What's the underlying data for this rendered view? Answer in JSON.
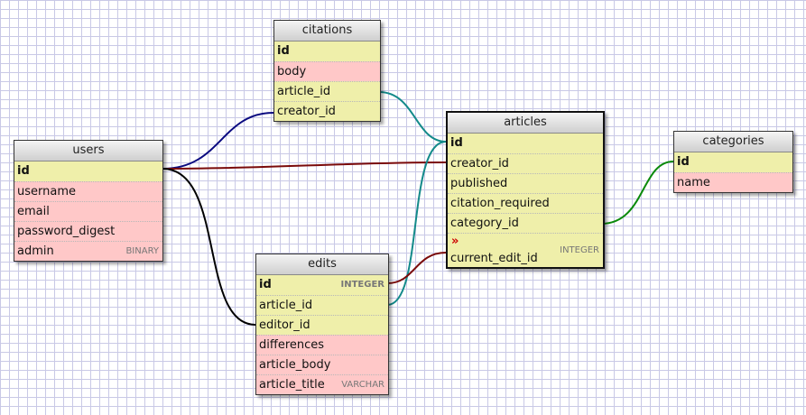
{
  "tables": {
    "citations": {
      "title": "citations",
      "fields": [
        {
          "name": "id",
          "type": ""
        },
        {
          "name": "body",
          "type": ""
        },
        {
          "name": "article_id",
          "type": ""
        },
        {
          "name": "creator_id",
          "type": ""
        }
      ]
    },
    "users": {
      "title": "users",
      "fields": [
        {
          "name": "id",
          "type": ""
        },
        {
          "name": "username",
          "type": ""
        },
        {
          "name": "email",
          "type": ""
        },
        {
          "name": "password_digest",
          "type": ""
        },
        {
          "name": "admin",
          "type": "BINARY"
        }
      ]
    },
    "articles": {
      "title": "articles",
      "fields": [
        {
          "name": "id",
          "type": ""
        },
        {
          "name": "creator_id",
          "type": ""
        },
        {
          "name": "published",
          "type": ""
        },
        {
          "name": "citation_required",
          "type": ""
        },
        {
          "name": "category_id",
          "type": ""
        },
        {
          "name": "current_edit_id",
          "type": "INTEGER",
          "marker": "»"
        }
      ]
    },
    "categories": {
      "title": "categories",
      "fields": [
        {
          "name": "id",
          "type": ""
        },
        {
          "name": "name",
          "type": ""
        }
      ]
    },
    "edits": {
      "title": "edits",
      "fields": [
        {
          "name": "id",
          "type": "INTEGER"
        },
        {
          "name": "article_id",
          "type": ""
        },
        {
          "name": "editor_id",
          "type": ""
        },
        {
          "name": "differences",
          "type": ""
        },
        {
          "name": "article_body",
          "type": ""
        },
        {
          "name": "article_title",
          "type": "VARCHAR"
        }
      ]
    }
  },
  "relations": [
    {
      "from": "citations.creator_id",
      "to": "users.id",
      "color": "#0a0a80"
    },
    {
      "from": "citations.article_id",
      "to": "articles.id",
      "color": "#138a8a"
    },
    {
      "from": "articles.creator_id",
      "to": "users.id",
      "color": "#7a0a0a"
    },
    {
      "from": "edits.editor_id",
      "to": "users.id",
      "color": "#000000"
    },
    {
      "from": "edits.article_id",
      "to": "articles.id",
      "color": "#138a8a"
    },
    {
      "from": "articles.current_edit_id",
      "to": "edits.id",
      "color": "#7a0a0a"
    },
    {
      "from": "articles.category_id",
      "to": "categories.id",
      "color": "#0a8a0a"
    }
  ],
  "colors": {
    "field_yellow": "#efefaa",
    "field_pink": "#ffc8c8",
    "grid": "#c9c9e6"
  }
}
